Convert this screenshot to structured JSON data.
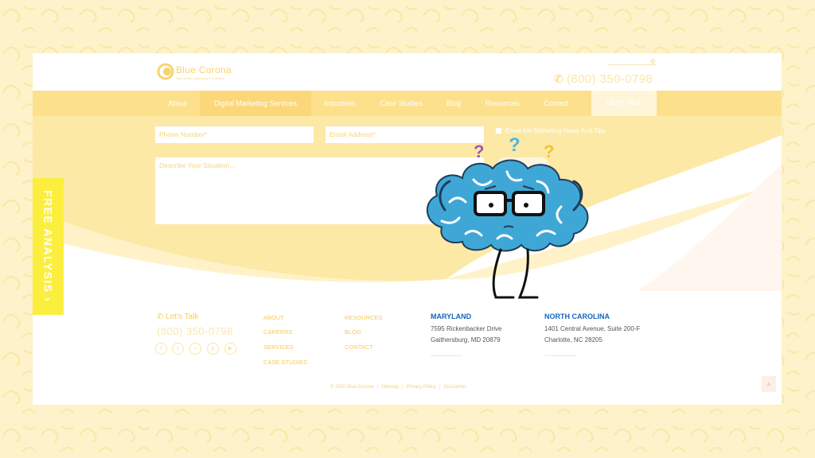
{
  "header": {
    "logo_text": "Blue Corona",
    "logo_tagline": "Data-Driven Marketing & Analytics",
    "phone": "(800) 350-0798"
  },
  "nav": {
    "items": [
      "About",
      "Digital Marketing Services",
      "Industries",
      "Case Studies",
      "Blog",
      "Resources",
      "Contact"
    ],
    "active_index": 1,
    "cta_label": "LET'S TALK"
  },
  "form": {
    "phone_placeholder": "Phone Number*",
    "email_placeholder": "Email Address*",
    "situation_placeholder": "Describe Your Situation...",
    "checkbox_label": "Email Me Marketing News And Tips"
  },
  "side_tab": {
    "label": "FREE ANALYSIS ›"
  },
  "footer": {
    "lets_talk": "Let's Talk",
    "phone": "(800) 350-0798",
    "social_icons": [
      "facebook-icon",
      "twitter-icon",
      "instagram-icon",
      "pinterest-icon",
      "youtube-icon"
    ],
    "links_col1": [
      "ABOUT",
      "CAREERS",
      "SERVICES",
      "CASE STUDIES"
    ],
    "links_col2": [
      "RESOURCES",
      "BLOG",
      "CONTACT"
    ],
    "offices": [
      {
        "state": "MARYLAND",
        "line1": "7595 Rickenbacker Drive",
        "line2": "Gaithersburg, MD 20879"
      },
      {
        "state": "NORTH CAROLINA",
        "line1": "1401 Central Avenue, Suite 200-F",
        "line2": "Charlotte, NC 28205"
      }
    ],
    "copyright": "© 2020 Blue Corona",
    "legal_links": [
      "Sitemap",
      "Privacy Policy",
      "Disclaimer"
    ]
  },
  "colors": {
    "brand_yellow": "#fde08b",
    "nav_active": "#fcd77a",
    "side_tab": "#fcee3f",
    "state_blue": "#1565c0",
    "brain_blue": "#3fa7d6"
  }
}
